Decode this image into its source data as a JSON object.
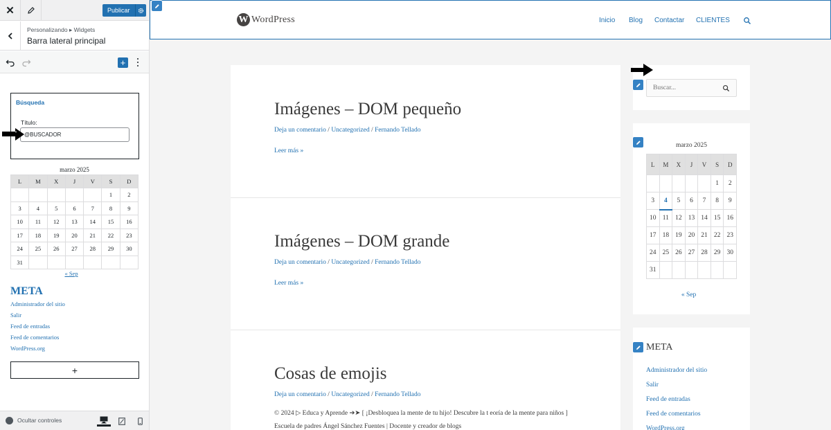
{
  "customizer": {
    "top": {
      "publish_label": "Publicar"
    },
    "header": {
      "breadcrumb": "Personalizando ▸ Widgets",
      "title": "Barra lateral principal"
    },
    "search_widget": {
      "name": "Búsqueda",
      "title_label": "Título:",
      "title_value": "@BUSCADOR"
    },
    "calendar": {
      "caption": "marzo 2025",
      "days": [
        "L",
        "M",
        "X",
        "J",
        "V",
        "S",
        "D"
      ],
      "weeks": [
        [
          "",
          "",
          "",
          "",
          "",
          "1",
          "2"
        ],
        [
          "3",
          "4",
          "5",
          "6",
          "7",
          "8",
          "9"
        ],
        [
          "10",
          "11",
          "12",
          "13",
          "14",
          "15",
          "16"
        ],
        [
          "17",
          "18",
          "19",
          "20",
          "21",
          "22",
          "23"
        ],
        [
          "24",
          "25",
          "26",
          "27",
          "28",
          "29",
          "30"
        ],
        [
          "31",
          "",
          "",
          "",
          "",
          "",
          ""
        ]
      ],
      "prev_link": "« Sep"
    },
    "meta": {
      "title": "META",
      "links": [
        "Administrador del sitio",
        "Salir",
        "Feed de entradas",
        "Feed de comentarios",
        "WordPress.org"
      ]
    },
    "add_block_label": "+",
    "footer": {
      "hide_label": "Ocultar controles"
    }
  },
  "preview": {
    "site": {
      "logo_mark": "W",
      "logo_text": "WordPress",
      "nav": [
        "Inicio",
        "Blog",
        "Contactar",
        "CLIENTES"
      ]
    },
    "posts": [
      {
        "title": "Imágenes – DOM pequeño",
        "comment_link": "Deja un comentario",
        "category": "Uncategorized",
        "author": "Fernando Tellado",
        "read_more": "Leer más »"
      },
      {
        "title": "Imágenes – DOM grande",
        "comment_link": "Deja un comentario",
        "category": "Uncategorized",
        "author": "Fernando Tellado",
        "read_more": "Leer más »"
      },
      {
        "title": "Cosas de emojis",
        "comment_link": "Deja un comentario",
        "category": "Uncategorized",
        "author": "Fernando Tellado",
        "excerpt": "© 2024 ▷ Educa y Aprende ➔➤ [ ¡Desbloquea la mente de tu hijo! Descubre la t eoría de la mente para niños ] Escuela de padres Ángel Sánchez Fuentes | Docente y creador de blogs"
      }
    ],
    "meta_separator": " / ",
    "search": {
      "placeholder": "Buscar..."
    },
    "calendar": {
      "caption": "marzo 2025",
      "days": [
        "L",
        "M",
        "X",
        "J",
        "V",
        "S",
        "D"
      ],
      "weeks": [
        [
          "",
          "",
          "",
          "",
          "",
          "1",
          "2"
        ],
        [
          "3",
          "4",
          "5",
          "6",
          "7",
          "8",
          "9"
        ],
        [
          "10",
          "11",
          "12",
          "13",
          "14",
          "15",
          "16"
        ],
        [
          "17",
          "18",
          "19",
          "20",
          "21",
          "22",
          "23"
        ],
        [
          "24",
          "25",
          "26",
          "27",
          "28",
          "29",
          "30"
        ],
        [
          "31",
          "",
          "",
          "",
          "",
          "",
          ""
        ]
      ],
      "today": "4",
      "prev_link": "« Sep"
    },
    "meta": {
      "title": "META",
      "links": [
        "Administrador del sitio",
        "Salir",
        "Feed de entradas",
        "Feed de comentarios",
        "WordPress.org"
      ]
    }
  },
  "colors": {
    "accent": "#2271b1",
    "edit_pencil": "#3582c4",
    "text": "#3a3a3a"
  }
}
